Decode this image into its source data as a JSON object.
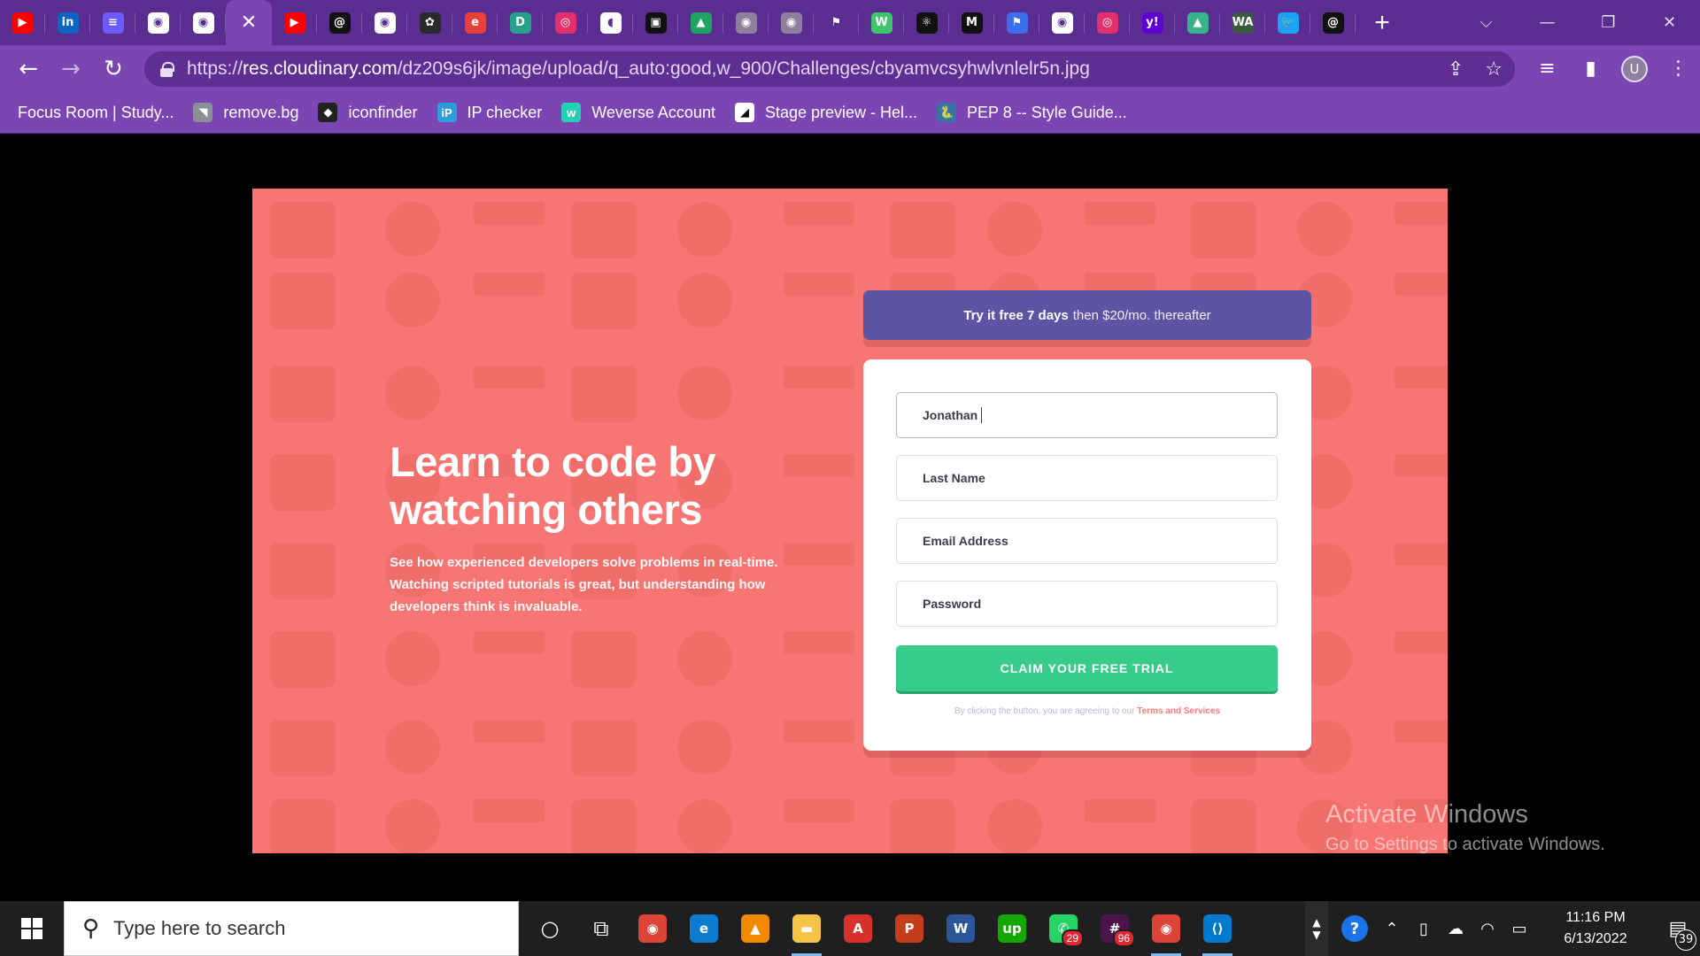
{
  "browser": {
    "tabs": [
      {
        "icon": "youtube-icon",
        "glyph": "▶",
        "color": "#ff0000"
      },
      {
        "icon": "linkedin-icon",
        "glyph": "in",
        "color": "#0a66c2"
      },
      {
        "icon": "stack-icon",
        "glyph": "≡",
        "color": "#6a5cff"
      },
      {
        "icon": "globe-icon",
        "glyph": "◉",
        "color": "#ffffff"
      },
      {
        "icon": "globe-icon",
        "glyph": "◉",
        "color": "#ffffff"
      },
      {
        "icon": "close-icon",
        "glyph": "✕",
        "color": "transparent",
        "active": true
      },
      {
        "icon": "youtube-icon",
        "glyph": "▶",
        "color": "#ff0000"
      },
      {
        "icon": "threads-icon",
        "glyph": "@",
        "color": "#111111"
      },
      {
        "icon": "globe-icon",
        "glyph": "◉",
        "color": "#ffffff"
      },
      {
        "icon": "gitkraken-icon",
        "glyph": "✿",
        "color": "#2a2a2a"
      },
      {
        "icon": "edureka-icon",
        "glyph": "e",
        "color": "#e8413d"
      },
      {
        "icon": "dribbble-icon",
        "glyph": "D",
        "color": "#28a08a"
      },
      {
        "icon": "instagram-icon",
        "glyph": "◎",
        "color": "#e1306c"
      },
      {
        "icon": "notion-icon",
        "glyph": "◖",
        "color": "#ffffff"
      },
      {
        "icon": "notes-icon",
        "glyph": "▣",
        "color": "#111111"
      },
      {
        "icon": "google-drive-icon",
        "glyph": "▲",
        "color": "#1fa463"
      },
      {
        "icon": "globe-icon",
        "glyph": "◉",
        "color": "#8e7f9f"
      },
      {
        "icon": "globe-icon",
        "glyph": "◉",
        "color": "#8e7f9f"
      },
      {
        "icon": "flag-icon",
        "glyph": "⚑",
        "color": "transparent"
      },
      {
        "icon": "webflow-icon",
        "glyph": "W",
        "color": "#3ec46d"
      },
      {
        "icon": "react-icon",
        "glyph": "⚛",
        "color": "#111111"
      },
      {
        "icon": "medium-icon",
        "glyph": "M",
        "color": "#111111"
      },
      {
        "icon": "flag-icon",
        "glyph": "⚑",
        "color": "#3b6ee8"
      },
      {
        "icon": "globe-icon",
        "glyph": "◉",
        "color": "#ffffff"
      },
      {
        "icon": "instagram-icon",
        "glyph": "◎",
        "color": "#e1306c"
      },
      {
        "icon": "yahoo-icon",
        "glyph": "y!",
        "color": "#5f01d1"
      },
      {
        "icon": "mountain-icon",
        "glyph": "▲",
        "color": "#3ab38a"
      },
      {
        "icon": "wa-icon",
        "glyph": "WA",
        "color": "#3a5a40"
      },
      {
        "icon": "twitter-icon",
        "glyph": "🐦",
        "color": "#1da1f2"
      },
      {
        "icon": "threads-icon",
        "glyph": "@",
        "color": "#111111"
      }
    ],
    "new_tab_glyph": "+",
    "window_controls": {
      "tab_search": "⌵",
      "minimize": "—",
      "restore": "❐",
      "close": "✕"
    },
    "nav": {
      "back": "←",
      "forward": "→",
      "reload": "↻"
    },
    "url": {
      "scheme": "https://",
      "host": "res.cloudinary.com",
      "path": "/dz209s6jk/image/upload/q_auto:good,w_900/Challenges/cbyamvcsyhwlvnlelr5n.jpg"
    },
    "omnibox_icons": {
      "share": "⇪",
      "star": "☆"
    },
    "toolbar_right": {
      "media": "≡",
      "side_panel": "▮",
      "profile": "U",
      "menu": "⋮"
    },
    "bookmarks": [
      {
        "label": "Focus Room | Study...",
        "icon": "focus-room-icon",
        "glyph": "",
        "color": "transparent"
      },
      {
        "label": "remove.bg",
        "icon": "removebg-icon",
        "glyph": "◥",
        "color": "#8a8f98"
      },
      {
        "label": "iconfinder",
        "icon": "iconfinder-icon",
        "glyph": "◆",
        "color": "#222222"
      },
      {
        "label": "IP checker",
        "icon": "ip-checker-icon",
        "glyph": "iP",
        "color": "#2d9cdb"
      },
      {
        "label": "Weverse Account",
        "icon": "weverse-icon",
        "glyph": "w",
        "color": "#25d0b3"
      },
      {
        "label": "Stage preview - Hel...",
        "icon": "stage-icon",
        "glyph": "◢",
        "color": "#ffffff"
      },
      {
        "label": "PEP 8 -- Style Guide...",
        "icon": "python-icon",
        "glyph": "🐍",
        "color": "#3873a4"
      }
    ]
  },
  "page": {
    "headline_line1": "Learn to code by",
    "headline_line2": "watching others",
    "description": "See how experienced developers solve problems in real-time. Watching scripted tutorials is great, but understanding how developers think is invaluable.",
    "offer_bold": "Try it free 7 days",
    "offer_rest": "then $20/mo. thereafter",
    "form": {
      "first_name_value": "Jonathan",
      "last_name_placeholder": "Last Name",
      "email_placeholder": "Email Address",
      "password_placeholder": "Password",
      "cta_label": "CLAIM YOUR FREE TRIAL",
      "terms_prefix": "By clicking the button, you are agreeing to our",
      "terms_link": "Terms and Services"
    },
    "colors": {
      "background": "#ff7a7a",
      "offer": "#5e54a4",
      "cta": "#38cc8b"
    }
  },
  "watermark": {
    "title": "Activate Windows",
    "subtitle": "Go to Settings to activate Windows."
  },
  "taskbar": {
    "search_placeholder": "Type here to search",
    "apps": [
      {
        "name": "cortana-icon",
        "glyph": "○",
        "color": "transparent"
      },
      {
        "name": "task-view-icon",
        "glyph": "⧉",
        "color": "transparent"
      },
      {
        "name": "chrome-icon",
        "glyph": "◉",
        "color": "#db4437"
      },
      {
        "name": "edge-icon",
        "glyph": "e",
        "color": "#0c7bd0"
      },
      {
        "name": "vlc-icon",
        "glyph": "▲",
        "color": "#f18a00"
      },
      {
        "name": "file-explorer-icon",
        "glyph": "▬",
        "color": "#f5c345",
        "active": true
      },
      {
        "name": "acrobat-icon",
        "glyph": "A",
        "color": "#d7312a"
      },
      {
        "name": "powerpoint-icon",
        "glyph": "P",
        "color": "#c43e1c"
      },
      {
        "name": "word-icon",
        "glyph": "W",
        "color": "#2b579a"
      },
      {
        "name": "upwork-icon",
        "glyph": "up",
        "color": "#14a800"
      },
      {
        "name": "whatsapp-icon",
        "glyph": "✆",
        "color": "#25d366",
        "badge": "29"
      },
      {
        "name": "slack-icon",
        "glyph": "#",
        "color": "#4a154b",
        "badge": "96"
      },
      {
        "name": "chrome-profile-icon",
        "glyph": "◉",
        "color": "#db4437",
        "active": true
      },
      {
        "name": "vscode-icon",
        "glyph": "⟨⟩",
        "color": "#007acc",
        "active": true
      }
    ],
    "tray": {
      "help": "?",
      "chevron": "⌃",
      "time": "11:16 PM",
      "date": "6/13/2022",
      "notifications": "39"
    }
  }
}
